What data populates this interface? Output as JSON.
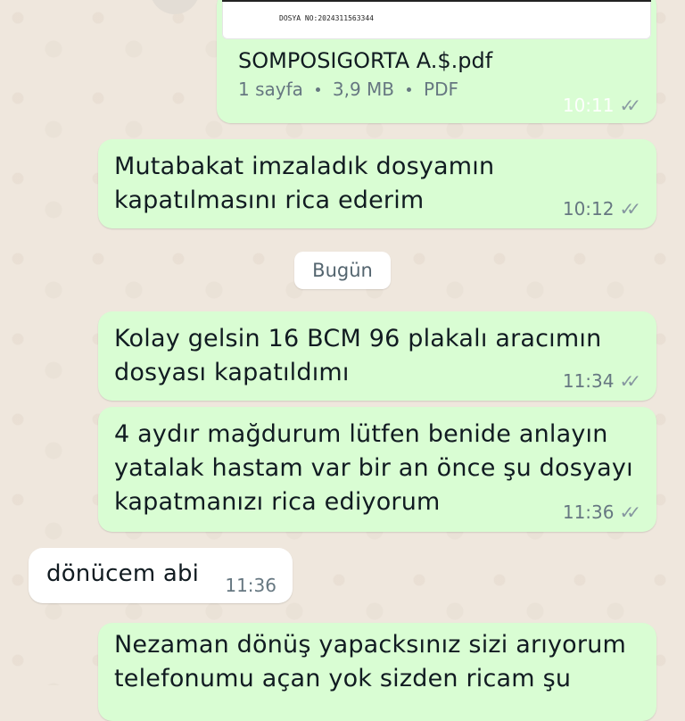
{
  "document_message": {
    "file_no": "DOSYA NO:2024311563344",
    "file_name": "SOMPOSIGORTA A.$.pdf",
    "pages": "1 sayfa",
    "size": "3,9 MB",
    "type": "PDF",
    "time": "10:11",
    "status_icon": "double-check-icon"
  },
  "messages_before": [
    {
      "text_lines": [
        "Mutabakat imzaladık dosyamın",
        "kapatılmasını rica ederim"
      ],
      "time": "10:12",
      "direction": "outgoing"
    }
  ],
  "date_separator": "Bugün",
  "messages_after": [
    {
      "text_lines": [
        "Kolay gelsin 16 BCM 96 plakalı aracımın",
        "dosyası kapatıldımı"
      ],
      "time": "11:34",
      "direction": "outgoing"
    },
    {
      "text_lines": [
        "4 aydır mağdurum lütfen benide anlayın",
        "yatalak hastam var bir an önce şu dosyayı",
        "kapatmanızı rica ediyorum"
      ],
      "time": "11:36",
      "direction": "outgoing"
    },
    {
      "text_lines": [
        "dönücem abi"
      ],
      "time": "11:36",
      "direction": "incoming"
    },
    {
      "text_lines": [
        "Nezaman dönüş yapacksınız sizi arıyorum",
        "telefonumu açan yok sizden ricam şu"
      ],
      "time": "",
      "direction": "outgoing"
    }
  ],
  "colors": {
    "outgoing_bubble": "#d9fdd3",
    "incoming_bubble": "#ffffff",
    "wallpaper": "#efe7dd",
    "meta_text": "#667781"
  }
}
